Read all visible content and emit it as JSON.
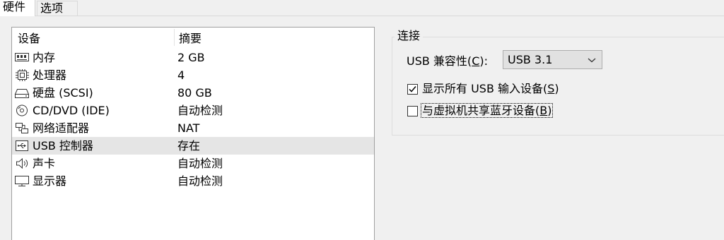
{
  "tabs": [
    {
      "label": "硬件",
      "active": true
    },
    {
      "label": "选项",
      "active": false
    }
  ],
  "device_list": {
    "headers": {
      "device": "设备",
      "summary": "摘要"
    },
    "rows": [
      {
        "name": "内存",
        "summary": "2 GB",
        "icon": "memory-icon"
      },
      {
        "name": "处理器",
        "summary": "4",
        "icon": "processor-icon"
      },
      {
        "name": "硬盘 (SCSI)",
        "summary": "80 GB",
        "icon": "hard-disk-icon"
      },
      {
        "name": "CD/DVD (IDE)",
        "summary": "自动检测",
        "icon": "cd-dvd-icon"
      },
      {
        "name": "网络适配器",
        "summary": "NAT",
        "icon": "network-adapter-icon"
      },
      {
        "name": "USB 控制器",
        "summary": "存在",
        "icon": "usb-icon",
        "selected": true
      },
      {
        "name": "声卡",
        "summary": "自动检测",
        "icon": "speaker-icon"
      },
      {
        "name": "显示器",
        "summary": "自动检测",
        "icon": "monitor-icon"
      }
    ]
  },
  "connection": {
    "title": "连接",
    "compat_label_prefix": "USB 兼容性(",
    "compat_label_accel": "C",
    "compat_label_suffix": "):",
    "compat_value": "USB 3.1",
    "show_all_prefix": "显示所有 USB 输入设备(",
    "show_all_accel": "S",
    "show_all_suffix": ")",
    "show_all_checked": true,
    "bluetooth_prefix": "与虚拟机共享蓝牙设备(",
    "bluetooth_accel": "B",
    "bluetooth_suffix": ")",
    "bluetooth_checked": false
  }
}
